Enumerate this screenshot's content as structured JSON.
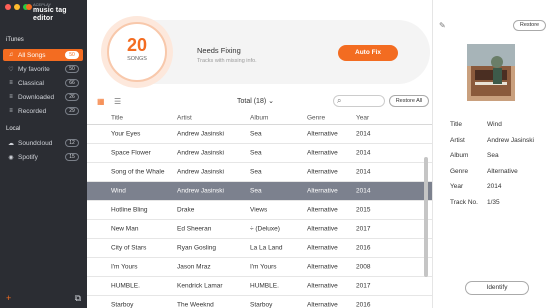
{
  "app": {
    "logo_small": "ACEPLAY",
    "logo_big": "music tag editor",
    "traffic_colors": [
      "#ff5f57",
      "#febc2e",
      "#28c840"
    ]
  },
  "sidebar": {
    "itunes_label": "iTunes",
    "local_label": "Local",
    "itunes_items": [
      {
        "label": "All Songs",
        "count": "50",
        "icon": "music-note-icon"
      },
      {
        "label": "My favorite",
        "count": "50",
        "icon": "heart-icon"
      },
      {
        "label": "Classical",
        "count": "66",
        "icon": "list-icon"
      },
      {
        "label": "Downloaded",
        "count": "26",
        "icon": "list-icon"
      },
      {
        "label": "Recorded",
        "count": "29",
        "icon": "list-icon"
      }
    ],
    "local_items": [
      {
        "label": "Soundcloud",
        "count": "12",
        "icon": "cloud-icon"
      },
      {
        "label": "Spotify",
        "count": "15",
        "icon": "spotify-icon"
      }
    ],
    "add_icon": "+",
    "window_icon": "⧉",
    "accent": "#f36c21"
  },
  "banner": {
    "count": "20",
    "unit": "SONGS",
    "title": "Needs Fixing",
    "subtitle": "Tracks with missing info.",
    "button": "Auto Fix"
  },
  "toolbar": {
    "total": "Total  (18)  ⌄",
    "search_placeholder": "",
    "restore_all": "Restore All"
  },
  "table": {
    "headers": [
      "Title",
      "Artist",
      "Album",
      "Genre",
      "Year"
    ],
    "rows": [
      [
        "Your Eyes",
        "Andrew Jasinski",
        "Sea",
        "Alternative",
        "2014"
      ],
      [
        "Space Flower",
        "Andrew Jasinski",
        "Sea",
        "Alternative",
        "2014"
      ],
      [
        "Song of the Whale",
        "Andrew Jasinski",
        "Sea",
        "Alternative",
        "2014"
      ],
      [
        "Wind",
        "Andrew Jasinski",
        "Sea",
        "Alternative",
        "2014"
      ],
      [
        "Hotline Bling",
        "Drake",
        "Views",
        "Alternative",
        "2015"
      ],
      [
        "New Man",
        "Ed Sheeran",
        "÷ (Deluxe)",
        "Alternative",
        "2017"
      ],
      [
        "City of Stars",
        "Ryan Gosling",
        "La La Land",
        "Alternative",
        "2016"
      ],
      [
        "I'm Yours",
        "Jason Mraz",
        "I'm Yours",
        "Alternative",
        "2008"
      ],
      [
        "HUMBLE.",
        "Kendrick Lamar",
        "HUMBLE.",
        "Alternative",
        "2017"
      ],
      [
        "Starboy",
        "The Weeknd",
        "Starboy",
        "Alternative",
        "2016"
      ]
    ],
    "selected_index": 3
  },
  "panel": {
    "restore": "Restore",
    "fields": [
      {
        "label": "Title",
        "value": "Wind"
      },
      {
        "label": "Artist",
        "value": "Andrew Jasinski"
      },
      {
        "label": "Album",
        "value": "Sea"
      },
      {
        "label": "Genre",
        "value": "Alternative"
      },
      {
        "label": "Year",
        "value": "2014"
      },
      {
        "label": "Track No.",
        "value": "1/35"
      }
    ],
    "identify": "Identify"
  }
}
